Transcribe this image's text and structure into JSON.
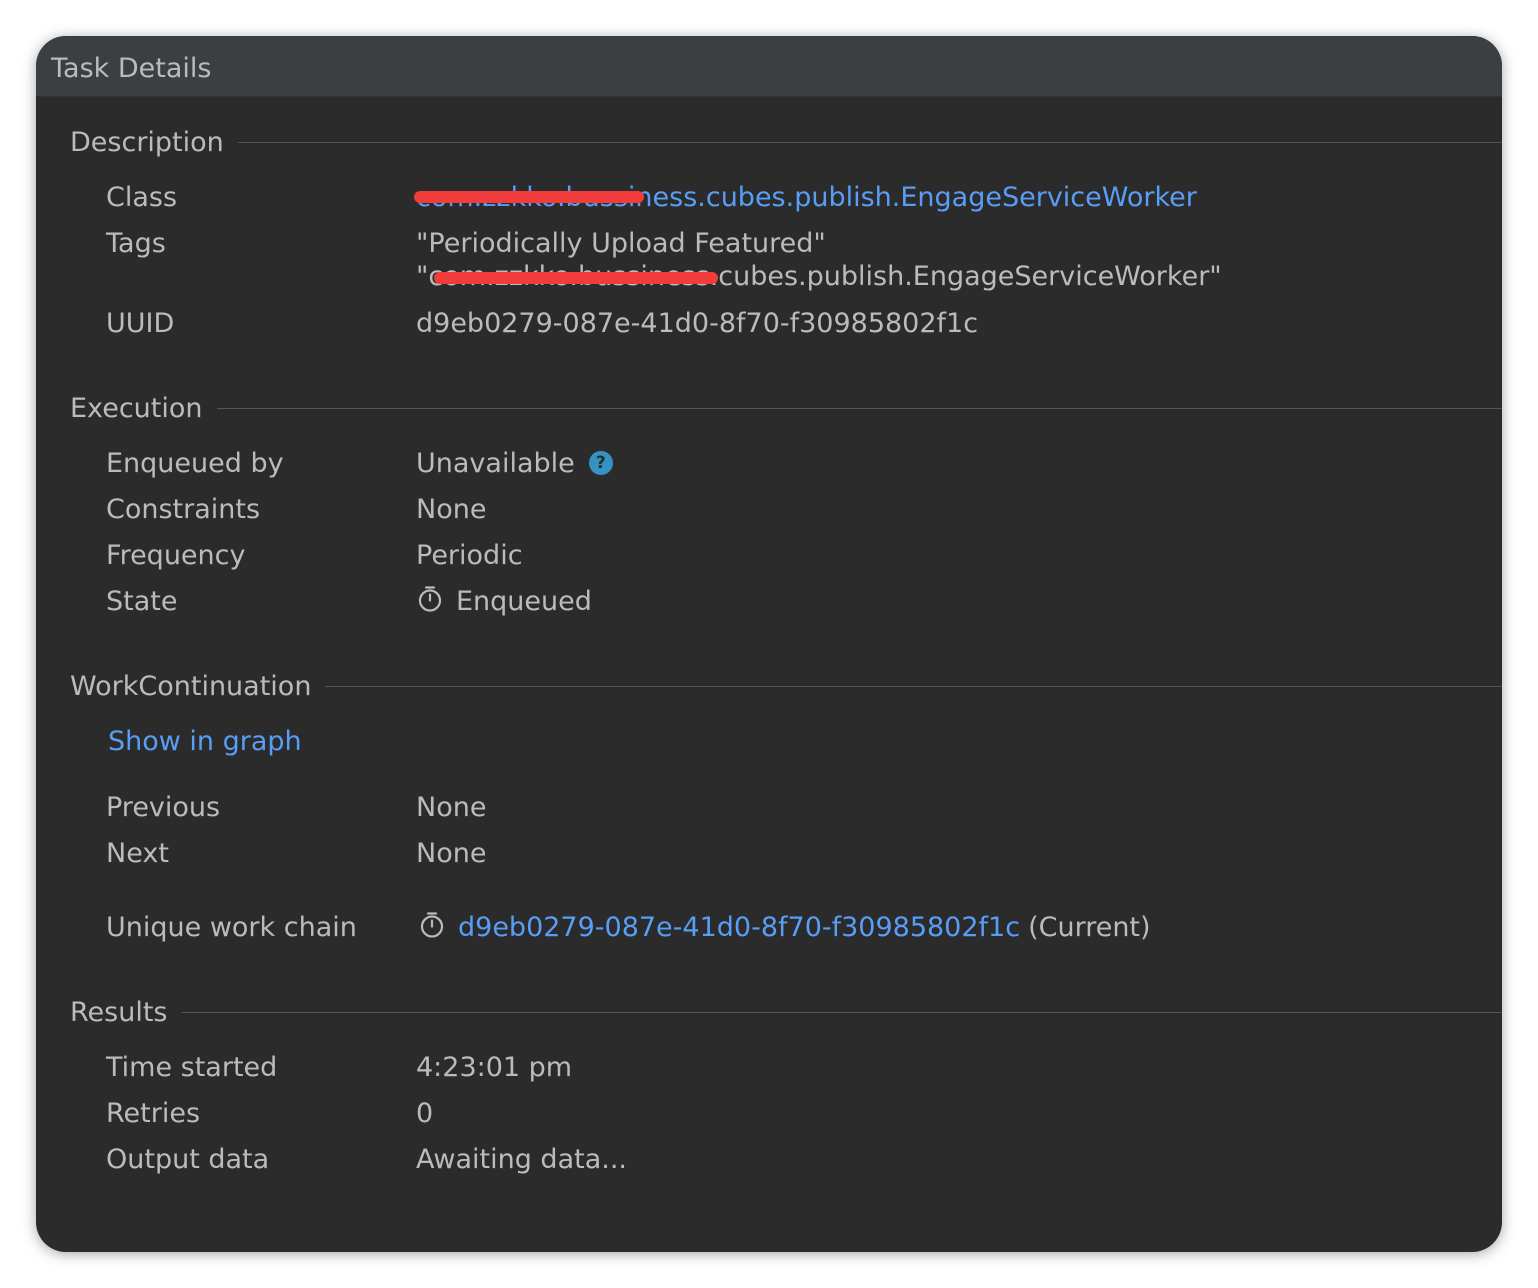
{
  "window": {
    "title": "Task Details"
  },
  "description": {
    "header": "Description",
    "class_label": "Class",
    "class_value": "com.zzkko.bussiness.cubes.publish.EngageServiceWorker",
    "tags_label": "Tags",
    "tags_values": [
      "\"Periodically Upload Featured\"",
      "\"com.zzkko.bussiness.cubes.publish.EngageServiceWorker\""
    ],
    "uuid_label": "UUID",
    "uuid_value": "d9eb0279-087e-41d0-8f70-f30985802f1c"
  },
  "execution": {
    "header": "Execution",
    "enqueued_by_label": "Enqueued by",
    "enqueued_by_value": "Unavailable",
    "help_icon": "question-circle-icon",
    "help_glyph": "?",
    "constraints_label": "Constraints",
    "constraints_value": "None",
    "frequency_label": "Frequency",
    "frequency_value": "Periodic",
    "state_label": "State",
    "state_icon": "stopwatch-icon",
    "state_value": "Enqueued"
  },
  "work_continuation": {
    "header": "WorkContinuation",
    "show_in_graph_label": "Show in graph",
    "previous_label": "Previous",
    "previous_value": "None",
    "next_label": "Next",
    "next_value": "None",
    "unique_chain_label": "Unique work chain",
    "unique_chain_icon": "stopwatch-icon",
    "unique_chain_link": "d9eb0279-087e-41d0-8f70-f30985802f1c",
    "unique_chain_suffix": "(Current)"
  },
  "results": {
    "header": "Results",
    "time_started_label": "Time started",
    "time_started_value": "4:23:01 pm",
    "retries_label": "Retries",
    "retries_value": "0",
    "output_data_label": "Output data",
    "output_data_value": "Awaiting data..."
  },
  "colors": {
    "background": "#2b2b2b",
    "titlebar": "#3c3f41",
    "text": "#bbbbbb",
    "link": "#589df6",
    "help_icon": "#3592c4",
    "redaction": "#f23c3c"
  }
}
